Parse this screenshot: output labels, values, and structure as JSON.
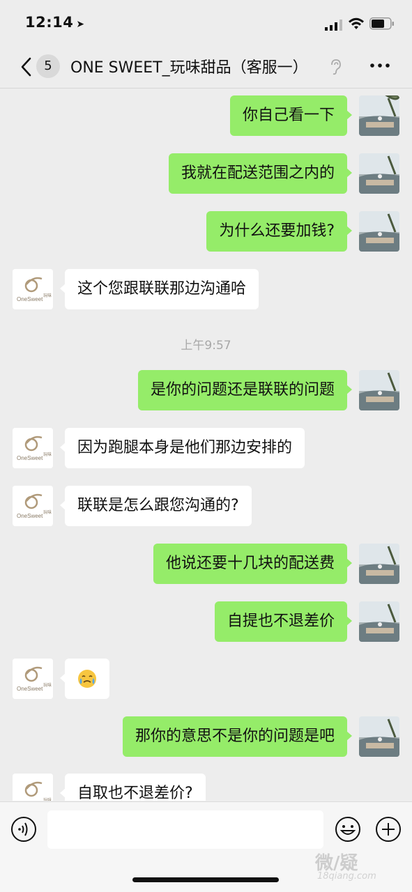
{
  "status_bar": {
    "time": "12:14"
  },
  "nav": {
    "back_count": "5",
    "title": "ONE SWEET_玩味甜品（客服一）"
  },
  "timestamp": "上午9:57",
  "shop_avatar": {
    "line1": "OneSweet",
    "line2": "玩味"
  },
  "messages_me": [
    "你自己看一下",
    "我就在配送范围之内的",
    "为什么还要加钱?",
    "是你的问题还是联联的问题",
    "他说还要十几块的配送费",
    "自提也不退差价",
    "那你的意思不是你的问题是吧"
  ],
  "messages_shop": [
    "这个您跟联联那边沟通哈",
    "因为跑腿本身是他们那边安排的",
    "联联是怎么跟您沟通的?",
    "😢",
    "自取也不退差价?"
  ],
  "watermark": {
    "main": "微/疑",
    "sub": "18qiang.com"
  }
}
